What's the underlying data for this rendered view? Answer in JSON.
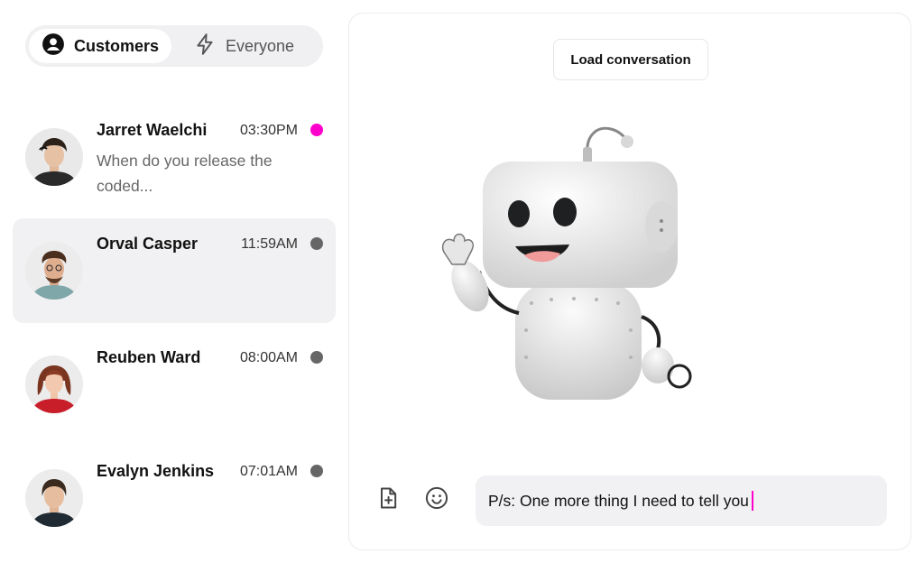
{
  "tabs": [
    {
      "label": "Customers",
      "icon": "user-circle-icon",
      "active": true
    },
    {
      "label": "Everyone",
      "icon": "lightning-icon",
      "active": false
    }
  ],
  "conversations": [
    {
      "name": "Jarret Waelchi",
      "time": "03:30PM",
      "preview": "When do you release the coded...",
      "status_color": "#ff00cc",
      "selected": false
    },
    {
      "name": "Orval Casper",
      "time": "11:59AM",
      "preview": "",
      "status_color": "#666666",
      "selected": true
    },
    {
      "name": "Reuben Ward",
      "time": "08:00AM",
      "preview": "",
      "status_color": "#666666",
      "selected": false
    },
    {
      "name": "Evalyn Jenkins",
      "time": "07:01AM",
      "preview": "",
      "status_color": "#666666",
      "selected": false
    }
  ],
  "chat": {
    "load_button_label": "Load conversation",
    "message_input_value": "P/s: One more thing I need to tell you",
    "icons": [
      "add-file-icon",
      "emoji-icon"
    ],
    "caret_color": "#ff00cc"
  }
}
